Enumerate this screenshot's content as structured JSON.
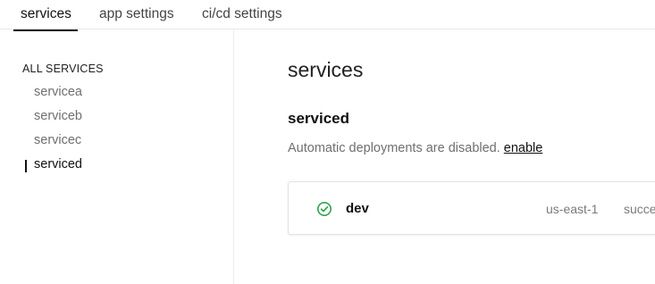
{
  "topnav": {
    "tabs": [
      {
        "label": "services",
        "active": true
      },
      {
        "label": "app settings",
        "active": false
      },
      {
        "label": "ci/cd settings",
        "active": false
      }
    ]
  },
  "sidebar": {
    "heading": "ALL SERVICES",
    "items": [
      {
        "label": "servicea",
        "active": false
      },
      {
        "label": "serviceb",
        "active": false
      },
      {
        "label": "servicec",
        "active": false
      },
      {
        "label": "serviced",
        "active": true
      }
    ]
  },
  "main": {
    "title": "services",
    "service_name": "serviced",
    "deploy_note": "Automatic deployments are disabled.",
    "enable_link": "enable",
    "environments": [
      {
        "name": "dev",
        "region": "us-east-1",
        "status": "succe",
        "status_icon": "check-circle-icon",
        "status_color": "#2ea44f"
      }
    ]
  }
}
